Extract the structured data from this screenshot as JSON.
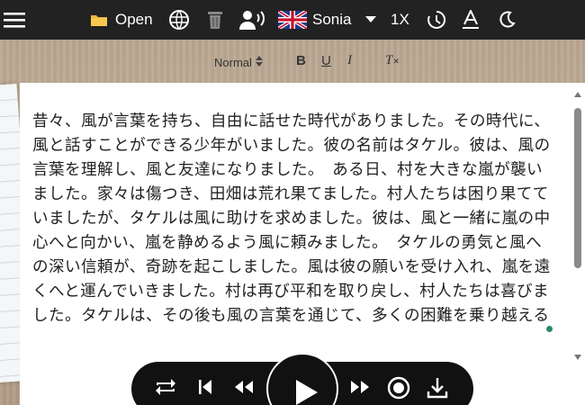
{
  "topbar": {
    "open_label": "Open",
    "voice_label": "Sonia",
    "speed_label": "1X",
    "icons": {
      "menu": "hamburger-menu-icon",
      "folder": "folder-icon",
      "web": "www-globe-icon",
      "trash": "trash-icon",
      "speaker": "speaker-person-icon",
      "flag": "uk-flag-icon",
      "chevron": "chevron-down-icon",
      "timer": "timer-icon",
      "font": "font-icon",
      "theme": "moon-icon"
    },
    "colors": {
      "background": "#222222",
      "text": "#ffffff"
    }
  },
  "format_toolbar": {
    "style_value": "Normal",
    "bold": "B",
    "underline": "U",
    "italic": "I",
    "clear": "T"
  },
  "editor": {
    "text": "昔々、風が言葉を持ち、自由に話せた時代がありました。その時代に、風と話すことができる少年がいました。彼の名前はタケル。彼は、風の言葉を理解し、風と友達になりました。　ある日、村を大きな嵐が襲いました。家々は傷つき、田畑は荒れ果てました。村人たちは困り果てていましたが、タケルは風に助けを求めました。彼は、風と一緒に嵐の中心へと向かい、嵐を静めるよう風に頼みました。　タケルの勇気と風への深い信頼が、奇跡を起こしました。風は彼の願いを受け入れ、嵐を遠くへと運んでいきました。村は再び平和を取り戻し、村人たちは喜びました。タケルは、その後も風の言葉を通じて、多くの困難を乗り越える"
  },
  "player": {
    "icons": [
      "repeat-icon",
      "skip-back-icon",
      "rewind-icon",
      "play-icon",
      "fast-forward-icon",
      "record-icon",
      "download-icon"
    ],
    "colors": {
      "background": "#111111",
      "accent": "#2b8a6e"
    }
  }
}
